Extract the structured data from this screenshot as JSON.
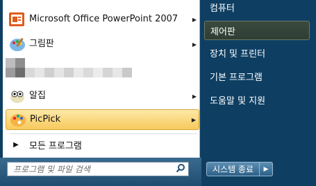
{
  "programs": [
    {
      "label": "Microsoft Office PowerPoint 2007",
      "icon": "powerpoint-icon",
      "has_submenu": true,
      "highlighted": false
    },
    {
      "label": "그림판",
      "icon": "paint-icon",
      "has_submenu": true,
      "highlighted": false
    },
    {
      "label": "알집",
      "icon": "alzip-icon",
      "has_submenu": true,
      "highlighted": false
    },
    {
      "label": "PicPick",
      "icon": "picpick-icon",
      "has_submenu": true,
      "highlighted": true
    }
  ],
  "all_programs": {
    "label": "모든 프로그램"
  },
  "search": {
    "placeholder": "프로그램 및 파일 검색",
    "icon": "search-icon"
  },
  "right_items": [
    {
      "label": "컴퓨터",
      "selected": false
    },
    {
      "label": "제어판",
      "selected": true
    },
    {
      "label": "장치 및 프린터",
      "selected": false
    },
    {
      "label": "기본 프로그램",
      "selected": false
    },
    {
      "label": "도움말 및 지원",
      "selected": false
    }
  ],
  "shutdown": {
    "label": "시스템 종료",
    "arrow_icon": "chevron-right-icon"
  },
  "colors": {
    "highlight": "#f7c95b",
    "pane_dark": "#0e3f63",
    "selected_right": "#2e3e35"
  }
}
